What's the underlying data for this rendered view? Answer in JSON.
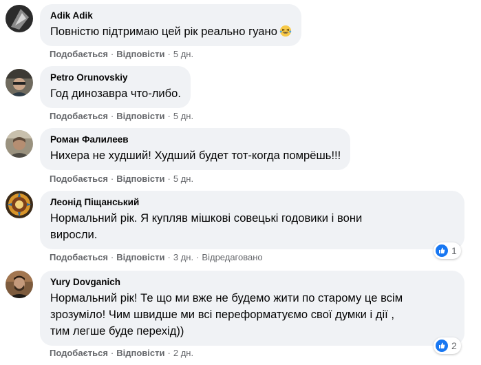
{
  "labels": {
    "like": "Подобається",
    "reply": "Відповісти",
    "separator": "·"
  },
  "colors": {
    "bubble": "#f0f2f5",
    "secondary_text": "#65676b",
    "like_blue": "#1877f2"
  },
  "comments": [
    {
      "author": "Adik Adik",
      "text_lines": [
        "Повністю підтримаю цей рік реально гуано"
      ],
      "emoji": "grinning-squinting-tears-emoji",
      "time": "5 дн."
    },
    {
      "author": "Petro Orunovskiy",
      "text_lines": [
        "Год динозавра что-либо."
      ],
      "time": "5 дн."
    },
    {
      "author": "Роман Фалилеев",
      "text_lines": [
        "Нихера не худший! Худший будет тот-когда помрёшь!!!"
      ],
      "time": "5 дн."
    },
    {
      "author": "Леонід Піщанський",
      "text_lines": [
        "Нормальний рік. Я купляв мішкові совецькі годовики і вони",
        "виросли."
      ],
      "time": "3 дн.",
      "edited": "Відредаговано",
      "reaction_icon": "like-icon",
      "reaction_count": "1"
    },
    {
      "author": "Yury Dovganich",
      "text_lines": [
        "Нормальний рік! Те що ми вже не будемо жити по старому це всім",
        "зрозуміло! Чим швидше ми всі переформатуємо свої думки і дії ,",
        "тим легше буде перехід))"
      ],
      "time": "2 дн.",
      "reaction_icon": "like-icon",
      "reaction_count": "2"
    }
  ]
}
